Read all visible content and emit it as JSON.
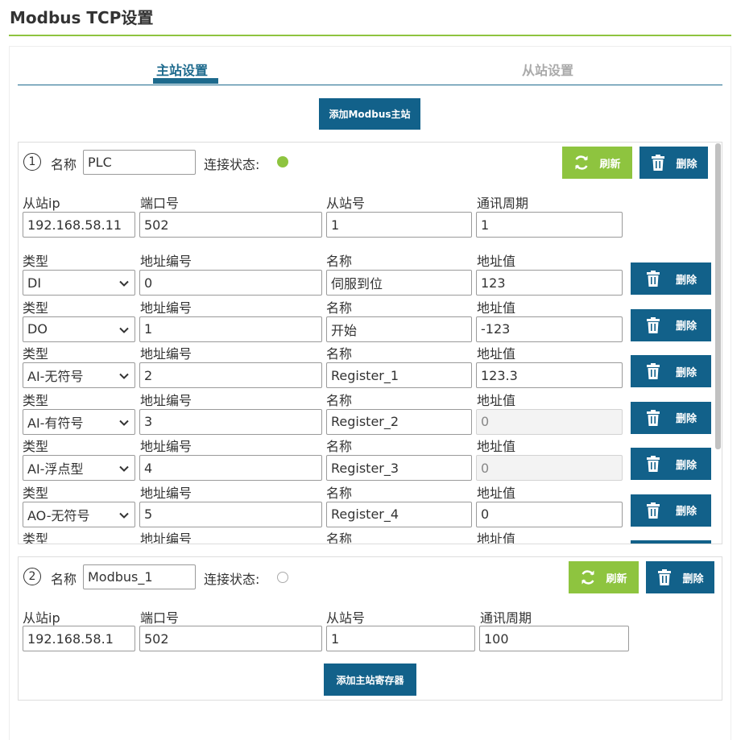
{
  "page_title": "Modbus TCP设置",
  "tabs": {
    "master": "主站设置",
    "slave": "从站设置"
  },
  "add_master_label": "添加Modbus主站",
  "masters": [
    {
      "index": "1",
      "name_label": "名称",
      "name": "PLC",
      "status_label": "连接状态:",
      "status": "connected",
      "refresh_label": "刷新",
      "delete_label": "删除",
      "slave_ip_label": "从站ip",
      "port_label": "端口号",
      "slave_id_label": "从站号",
      "period_label": "通讯周期",
      "slave_ip": "192.168.58.11",
      "port": "502",
      "slave_id": "1",
      "period": "1",
      "reg_headers": {
        "type": "类型",
        "address": "地址编号",
        "name": "名称",
        "value": "地址值"
      },
      "registers": [
        {
          "type": "DI",
          "address": "0",
          "name": "伺服到位",
          "value": "123",
          "disabled": false,
          "delete": "删除"
        },
        {
          "type": "DO",
          "address": "1",
          "name": "开始",
          "value": "-123",
          "disabled": false,
          "delete": "删除"
        },
        {
          "type": "AI-无符号",
          "address": "2",
          "name": "Register_1",
          "value": "123.3",
          "disabled": false,
          "delete": "删除"
        },
        {
          "type": "AI-有符号",
          "address": "3",
          "name": "Register_2",
          "value": "0",
          "disabled": true,
          "delete": "删除"
        },
        {
          "type": "AI-浮点型",
          "address": "4",
          "name": "Register_3",
          "value": "0",
          "disabled": true,
          "delete": "删除"
        },
        {
          "type": "AO-无符号",
          "address": "5",
          "name": "Register_4",
          "value": "0",
          "disabled": false,
          "delete": "删除"
        },
        {
          "type": "",
          "address": "",
          "name": "",
          "value": "",
          "disabled": false,
          "delete": ""
        }
      ]
    },
    {
      "index": "2",
      "name_label": "名称",
      "name": "Modbus_1",
      "status_label": "连接状态:",
      "status": "disconnected",
      "refresh_label": "刷新",
      "delete_label": "删除",
      "slave_ip_label": "从站ip",
      "port_label": "端口号",
      "slave_id_label": "从站号",
      "period_label": "通讯周期",
      "slave_ip": "192.168.58.1",
      "port": "502",
      "slave_id": "1",
      "period": "100",
      "add_register_label": "添加主站寄存器"
    }
  ],
  "colors": {
    "primary": "#12618a",
    "accent": "#8ec43f",
    "tab_active": "#1d6a8d",
    "tab_inactive": "#aaaaaa"
  }
}
